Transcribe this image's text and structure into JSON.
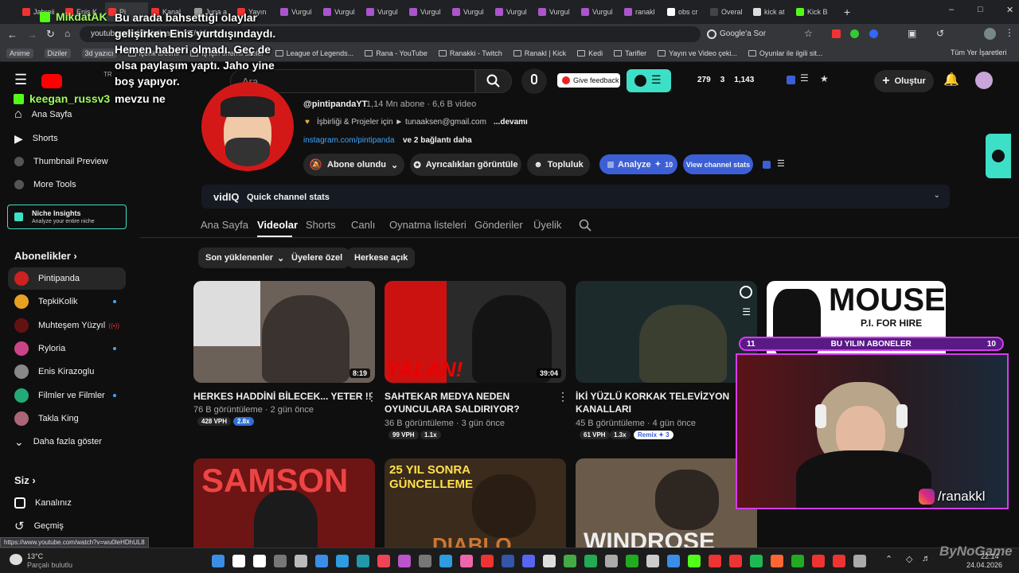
{
  "browser": {
    "tabs": [
      "Jahreii",
      "Enis K",
      "Pi",
      "Kanal",
      "Juna a",
      "Yayın",
      "Vurgul",
      "Vurgul",
      "Vurgul",
      "Vurgul",
      "Vurgul",
      "Vurgul",
      "Vurgul",
      "Vurgul",
      "ranakl",
      "obs cr",
      "Overal",
      "kick at",
      "Kick B"
    ],
    "url": "youtube.com/@pintipandaYT/videos",
    "google_label": "Google'a Sor",
    "bookmarks": [
      "Anime",
      "Diziler",
      "3d yazıcı",
      "içerik üretimi",
      "İş için önemli siteler",
      "League of Legends...",
      "Rana - YouTube",
      "Ranakki - Twitch",
      "Ranakl | Kick",
      "Kedi",
      "Tarifler",
      "Yayın ve Video çeki...",
      "Oyunlar ile ilgili sit..."
    ],
    "all_bookmarks": "Tüm Yer İşaretleri"
  },
  "header": {
    "search_placeholder": "Ara",
    "feedback": "Give feedback",
    "stats": [
      "279",
      "3",
      "1,143"
    ],
    "create": "Oluştur",
    "region": "TR"
  },
  "sidebar": {
    "items": [
      "Ana Sayfa",
      "Shorts",
      "Thumbnail Preview",
      "More Tools"
    ],
    "niche_title": "Niche Insights",
    "niche_sub": "Analyze your entire niche",
    "subs_title": "Abonelikler",
    "subs": [
      "Pintipanda",
      "TepkiKolik",
      "Muhteşem Yüzyıl",
      "Ryloria",
      "Enis Kirazoglu",
      "Filmler ve Filmler",
      "Takla King",
      "Daha fazla göster"
    ],
    "you_title": "Siz",
    "you_items": [
      "Kanalınız",
      "Geçmiş"
    ]
  },
  "channel": {
    "handle": "@pintipandaYT",
    "meta": "1,14 Mn abone · 6,6 B video",
    "desc": "İşbirliği & Projeler için ► tunaaksen@gmail.com",
    "more": "...devamı",
    "link": "instagram.com/pintipanda",
    "link_more": "ve 2 bağlantı daha",
    "subscribed": "Abone olundu",
    "perks": "Ayrıcalıkları görüntüle",
    "community": "Topluluk",
    "analyze": "Analyze",
    "analyze_count": "10",
    "view_stats": "View channel stats",
    "vidiq": "vidIQ",
    "quick_stats": "Quick channel stats"
  },
  "tabs": [
    "Ana Sayfa",
    "Videolar",
    "Shorts",
    "Canlı",
    "Oynatma listeleri",
    "Gönderiler",
    "Üyelik"
  ],
  "chips": [
    "Son yüklenenler",
    "Üyelere özel",
    "Herkese açık"
  ],
  "videos": [
    {
      "title1": "HERKES HADDİNİ BİLECEK... YETER !!",
      "title2": "",
      "meta": "76 B görüntüleme · 2 gün önce",
      "duration": "8:19",
      "vph": "428 VPH",
      "mult": "2.8x",
      "color": "#6b6158"
    },
    {
      "title1": "SAHTEKAR MEDYA NEDEN",
      "title2": "OYUNCULARA SALDIRIYOR?",
      "meta": "36 B görüntüleme · 3 gün önce",
      "duration": "39:04",
      "vph": "99 VPH",
      "mult": "1.1x",
      "color": "#2a2a2a"
    },
    {
      "title1": "İKİ YÜZLÜ KORKAK TELEVİZYON",
      "title2": "KANALLARI",
      "meta": "45 B görüntüleme · 4 gün önce",
      "duration": "",
      "vph": "61 VPH",
      "mult": "1.3x",
      "remix": "Remix",
      "remix_n": "3",
      "color": "#1d2a2c"
    }
  ],
  "row2": {
    "t1": "SAMSON",
    "t2_a": "25 YIL SONRA",
    "t2_b": "GÜNCELLEME",
    "t2_c": "DIABLO",
    "t3": "WINDROSE",
    "t4": "MOUSE",
    "t4_sub": "P.I. FOR HIRE"
  },
  "overlay": {
    "chat": [
      {
        "name": "MikdatAK",
        "msg": "Bu arada bahsettiği olaylar gelişirken Enis yurtdışındaydı. Hemen haberi olmadı. Geç de olsa paylaşım yaptı. Jaho yine boş yapıyor."
      },
      {
        "name": "keegan_russv3",
        "msg": "mevzu ne"
      }
    ],
    "sub_bar_left": "11",
    "sub_bar_label": "BU YILIN ABONELER",
    "sub_bar_right": "10",
    "ig": "/ranakkl",
    "watermark": "ByNoGame"
  },
  "status_url": "https://www.youtube.com/watch?v=wu0leHDhUL8",
  "taskbar": {
    "weather_temp": "13°C",
    "weather_desc": "Parçalı bulutlu",
    "time": "22:14",
    "date": "24.04.2026"
  }
}
